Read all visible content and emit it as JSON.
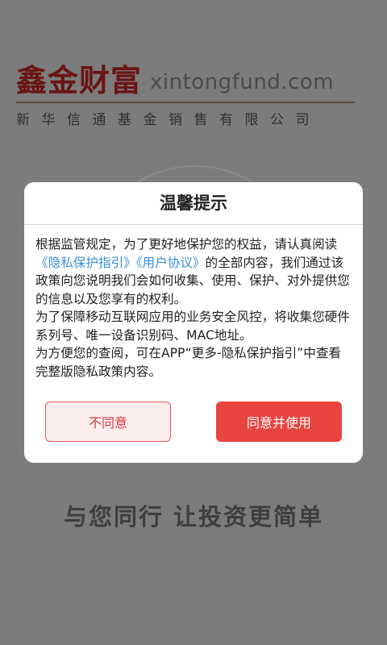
{
  "logo": {
    "brand_cn": "鑫金财富",
    "domain": "xintongfund.com",
    "company": "新华信通基金销售有限公司"
  },
  "slogan": "与您同行 让投资更简单",
  "dialog": {
    "title": "温馨提示",
    "para1_prefix": "根据监管规定，为了更好地保护您的权益，请认真阅读",
    "privacy_link": "《隐私保护指引》",
    "user_link": "《用户协议》",
    "para1_suffix": "的全部内容，我们通过该政策向您说明我们会如何收集、使用、保护、对外提供您的信息以及您享有的权利。",
    "para2": "为了保障移动互联网应用的业务安全风控，将收集您硬件系列号、唯一设备识别码、MAC地址。",
    "para3": "为方便您的查阅，可在APP“更多-隐私保护指引”中查看完整版隐私政策内容。",
    "deny_label": "不同意",
    "agree_label": "同意并使用"
  },
  "colors": {
    "accent": "#e8443f",
    "link": "#3b8fd6",
    "overlay": "#7c7c7c"
  }
}
